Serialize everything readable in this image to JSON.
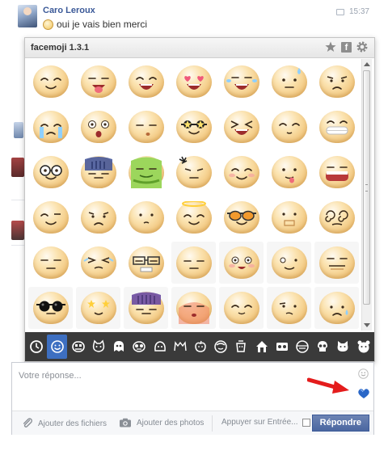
{
  "message": {
    "author": "Caro Leroux",
    "text": "oui je vais bien merci",
    "time": "15:37"
  },
  "panel": {
    "title": "facemoji 1.3.1",
    "header_icons": [
      "star-icon",
      "facebook-icon",
      "gear-icon"
    ]
  },
  "emoji_grid": [
    [
      "smile",
      "tongue-out",
      "grin",
      "heart-eyes",
      "laugh-tears",
      "sweat-drop",
      "worried"
    ],
    [
      "crying",
      "shocked",
      "sleepy",
      "star-glasses",
      "squint-laugh",
      "content",
      "big-grin"
    ],
    [
      "nerd-glasses",
      "blue-gloom",
      "sick-green",
      "angry-vein",
      "smile-blush",
      "tongue-side",
      "wide-grin"
    ],
    [
      "wink",
      "frown",
      "pout",
      "angel",
      "sunglasses-orange",
      "closed-mouth",
      "dizzy-eyes"
    ],
    [
      "neutral",
      "squint-tears",
      "unamused-glasses",
      "flat",
      "grin-blush",
      "derp",
      "meh"
    ],
    [
      "cool-sunglasses",
      "star-eyes",
      "purple-gloom",
      "red-sad",
      "happy-closed",
      "confused",
      "sad-drop"
    ]
  ],
  "categories": [
    "clock-icon",
    "smiley-icon",
    "monster-icon",
    "cat-icon",
    "ghost-icon",
    "eye-mask-icon",
    "blob-icon",
    "cat-outline-icon",
    "apple-icon",
    "face-icon",
    "bucket-icon",
    "house-icon",
    "cassette-icon",
    "brick-icon",
    "skull-icon",
    "kitty-icon",
    "bear-icon"
  ],
  "active_category": 1,
  "reply": {
    "placeholder": "Votre réponse...",
    "add_files": "Ajouter des fichiers",
    "add_photos": "Ajouter des photos",
    "press_enter": "Appuyer sur Entrée...",
    "reply_button": "Répondre"
  },
  "colors": {
    "link_blue": "#3b5998",
    "category_bar": "#3a3a3a",
    "active_category": "#3d6fc1",
    "arrow_red": "#e41c1c"
  }
}
